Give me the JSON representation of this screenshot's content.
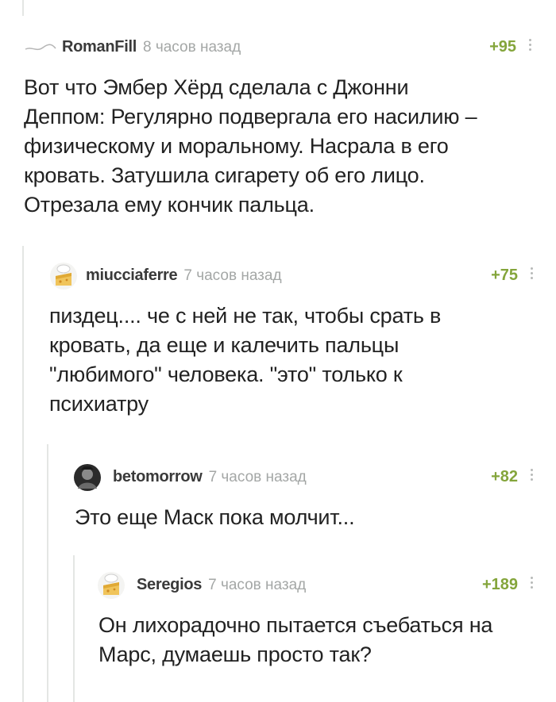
{
  "comments": [
    {
      "author": "RomanFill",
      "time": "8 часов назад",
      "rating": "+95",
      "lines": [
        "Вот что Эмбер Хёрд сделала с Джонни",
        "Деппом: Регулярно подвергала его насилию –",
        "физическому и моральному. Насрала в его",
        "кровать. Затушила сигарету об его лицо.",
        "Отрезала ему кончик пальца."
      ]
    },
    {
      "author": "miucciaferre",
      "time": "7 часов назад",
      "rating": "+75",
      "lines": [
        "пиздец.... че с ней не так, чтобы срать в",
        "кровать, да еще и калечить пальцы",
        "\"любимого\" человека. \"это\" только к",
        "психиатру"
      ]
    },
    {
      "author": "betomorrow",
      "time": "7 часов назад",
      "rating": "+82",
      "lines": [
        "Это еще Маск пока молчит..."
      ]
    },
    {
      "author": "Seregios",
      "time": "7 часов назад",
      "rating": "+189",
      "lines": [
        "Он лихорадочно пытается съебаться на",
        "Марс, думаешь просто так?"
      ]
    }
  ],
  "colors": {
    "rating": "#84a53b",
    "meta": "#a4a7a6",
    "thread_line": "#e4e6e4",
    "text": "#222222"
  }
}
